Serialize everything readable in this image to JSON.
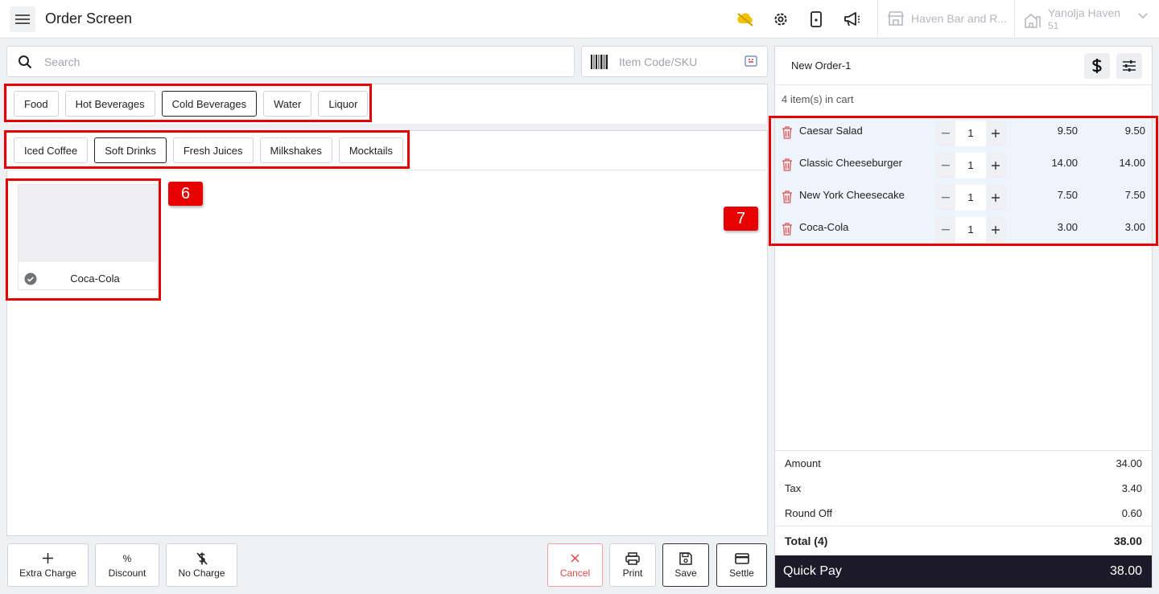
{
  "header": {
    "title": "Order Screen",
    "outlet": "Haven Bar and R...",
    "property_name": "Yanolja Haven",
    "property_id": "51"
  },
  "search": {
    "placeholder": "Search"
  },
  "sku": {
    "placeholder": "Item Code/SKU"
  },
  "categories": [
    "Food",
    "Hot Beverages",
    "Cold Beverages",
    "Water",
    "Liquor"
  ],
  "active_category": "Cold Beverages",
  "subcategories": [
    "Iced Coffee",
    "Soft Drinks",
    "Fresh Juices",
    "Milkshakes",
    "Mocktails"
  ],
  "active_subcategory": "Soft Drinks",
  "items": [
    {
      "name": "Coca-Cola",
      "selected": true
    }
  ],
  "annotations": {
    "left": "6",
    "right": "7"
  },
  "actions": {
    "extra_charge": "Extra Charge",
    "discount_symbol": "%",
    "discount": "Discount",
    "no_charge": "No Charge",
    "cancel": "Cancel",
    "print": "Print",
    "save": "Save",
    "settle": "Settle"
  },
  "order": {
    "name": "New Order-1",
    "cart_count": "4 item(s) in cart",
    "lines": [
      {
        "name": "Caesar Salad",
        "qty": "1",
        "price": "9.50",
        "total": "9.50"
      },
      {
        "name": "Classic Cheeseburger",
        "qty": "1",
        "price": "14.00",
        "total": "14.00"
      },
      {
        "name": "New York Cheesecake",
        "qty": "1",
        "price": "7.50",
        "total": "7.50"
      },
      {
        "name": "Coca-Cola",
        "qty": "1",
        "price": "3.00",
        "total": "3.00"
      }
    ],
    "summary": {
      "amount_label": "Amount",
      "amount": "34.00",
      "tax_label": "Tax",
      "tax": "3.40",
      "roundoff_label": "Round Off",
      "roundoff": "0.60",
      "total_label": "Total (4)",
      "total": "38.00"
    },
    "quick_pay_label": "Quick Pay",
    "quick_pay_amount": "38.00"
  },
  "colors": {
    "highlight": "#e60000",
    "cart_row_bg": "#eef4fb",
    "quick_pay_bg": "#1c1a28",
    "delete_icon": "#e05050",
    "weather_icon": "#f2c200"
  },
  "icons": [
    "menu-icon",
    "weather-icon",
    "settings-icon",
    "tablet-icon",
    "megaphone-icon",
    "store-icon",
    "building-icon",
    "chevron-down-icon",
    "search-icon",
    "barcode-icon",
    "keyboard-icon",
    "check-circle-icon",
    "plus-icon",
    "no-charge-icon",
    "close-icon",
    "printer-icon",
    "floppy-icon",
    "card-icon",
    "dollar-icon",
    "sliders-icon",
    "trash-icon",
    "minus-icon"
  ]
}
